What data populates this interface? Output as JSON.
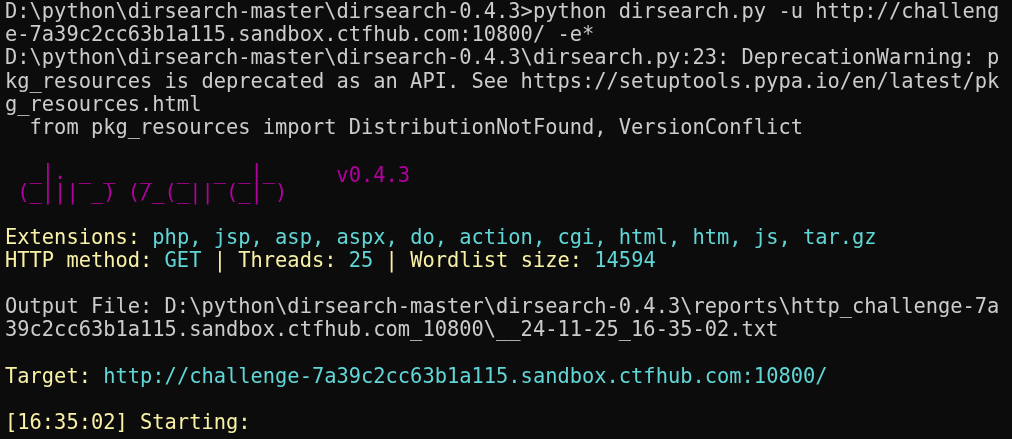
{
  "terminal": {
    "blocks": [
      {
        "lines": [
          [
            {
              "kind": "plain",
              "text": "D:\\python\\dirsearch-master\\dirsearch-0.4.3>python dirsearch.py -u http://challeng"
            }
          ],
          [
            {
              "kind": "plain",
              "text": "e-7a39c2cc63b1a115.sandbox.ctfhub.com:10800/ -e*"
            }
          ],
          [
            {
              "kind": "plain",
              "text": "D:\\python\\dirsearch-master\\dirsearch-0.4.3\\dirsearch.py:23: DeprecationWarning: p"
            }
          ],
          [
            {
              "kind": "plain",
              "text": "kg_resources is deprecated as an API. See https://setuptools.pypa.io/en/latest/pk"
            }
          ],
          [
            {
              "kind": "plain",
              "text": "g_resources.html"
            }
          ],
          [
            {
              "kind": "plain",
              "text": "  from pkg_resources import DistributionNotFound, VersionConflict"
            }
          ]
        ]
      },
      {
        "logo": {
          "art": [
            "  _|. _ _  _  _  _ _|_",
            " (_||| _) (/_(_|| (_| )"
          ],
          "version": "v0.4.3"
        }
      },
      {
        "lines": [
          [
            {
              "kind": "label",
              "text": "Extensions: "
            },
            {
              "kind": "value",
              "text": "php, jsp, asp, aspx, do, action, cgi, html, htm, js, tar.gz"
            }
          ],
          [
            {
              "kind": "label",
              "text": "HTTP method: "
            },
            {
              "kind": "value",
              "text": "GET"
            },
            {
              "kind": "label",
              "text": " | Threads: "
            },
            {
              "kind": "value",
              "text": "25"
            },
            {
              "kind": "label",
              "text": " | Wordlist size: "
            },
            {
              "kind": "value",
              "text": "14594"
            }
          ]
        ]
      },
      {
        "lines": [
          [
            {
              "kind": "plain",
              "text": "Output File: D:\\python\\dirsearch-master\\dirsearch-0.4.3\\reports\\http_challenge-7a"
            }
          ],
          [
            {
              "kind": "plain",
              "text": "39c2cc63b1a115.sandbox.ctfhub.com_10800\\__24-11-25_16-35-02.txt"
            }
          ]
        ]
      },
      {
        "lines": [
          [
            {
              "kind": "label",
              "text": "Target: "
            },
            {
              "kind": "value",
              "text": "http://challenge-7a39c2cc63b1a115.sandbox.ctfhub.com:10800/"
            }
          ]
        ]
      },
      {
        "lines": [
          [
            {
              "kind": "label",
              "text": "[16:35:02] Starting:"
            }
          ]
        ]
      }
    ]
  }
}
